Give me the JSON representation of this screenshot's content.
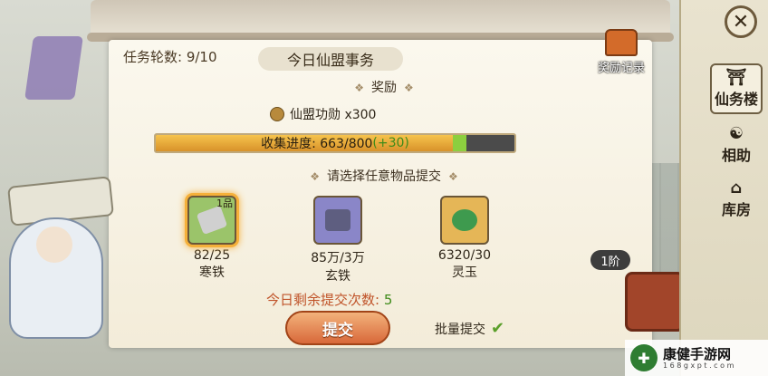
{
  "header": {
    "round_label": "任务轮数: 9/10",
    "title": "今日仙盟事务",
    "reward_log": "奖励记录"
  },
  "reward_section": {
    "heading": "奖励",
    "reward_text": "仙盟功勋 x300"
  },
  "progress": {
    "label": "收集进度: 663/800",
    "bonus": "(+30)",
    "current": 663,
    "max": 800,
    "bonus_value": 30
  },
  "select_heading": "请选择任意物品提交",
  "items": [
    {
      "name": "寒铁",
      "count": "82/25",
      "grade": "1品",
      "color": "#cfcfcf",
      "selected": true
    },
    {
      "name": "玄铁",
      "count": "85万/3万",
      "color": "#6f6f9a"
    },
    {
      "name": "灵玉",
      "count": "6320/30",
      "color": "#3e9a4e"
    }
  ],
  "remaining": {
    "label": "今日剩余提交次数:",
    "value": "5"
  },
  "submit_label": "提交",
  "batch_label": "批量提交",
  "tier_label": "1阶",
  "sidebar": {
    "items": [
      {
        "label": "仙务楼",
        "icon": "pavilion-icon"
      },
      {
        "label": "相助",
        "icon": "helper-icon"
      },
      {
        "label": "库房",
        "icon": "storehouse-icon"
      }
    ]
  },
  "watermark": {
    "title": "康健手游网",
    "sub": "1 6 8 g x p t . c o m"
  }
}
